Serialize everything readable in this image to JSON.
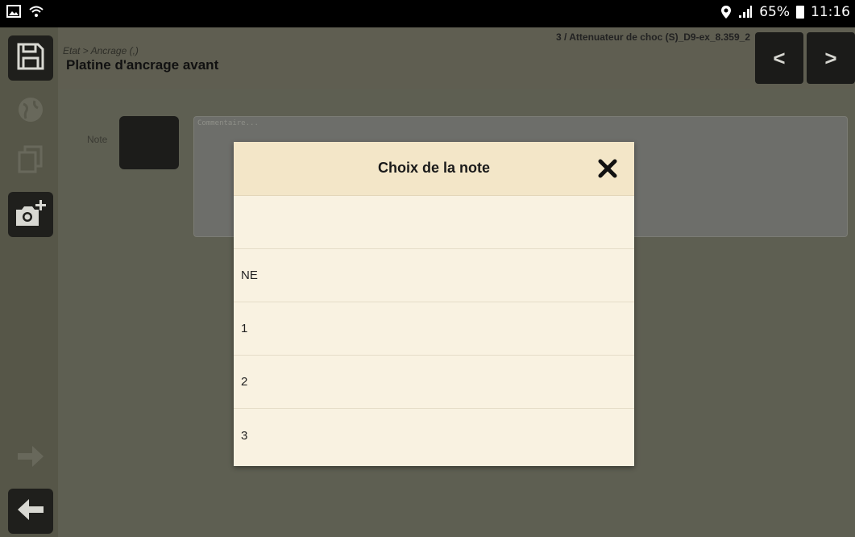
{
  "status_bar": {
    "battery": "65%",
    "time": "11:16",
    "icons": [
      "gallery-icon",
      "wifi-icon",
      "location-icon",
      "signal-icon",
      "battery-icon"
    ]
  },
  "rail": {
    "icons": [
      "save-icon",
      "globe-icon",
      "copy-icon",
      "camera-add-icon",
      "arrow-right-icon",
      "arrow-left-icon"
    ]
  },
  "header": {
    "breadcrumb": "Etat > Ancrage (,)",
    "title": "Platine d'ancrage avant",
    "record": "3 / Attenuateur de choc (S)_D9-ex_8.359_2",
    "prev_label": "<",
    "next_label": ">"
  },
  "form": {
    "note_label": "Note",
    "comment_placeholder": "Commentaire..."
  },
  "modal": {
    "title": "Choix de la note",
    "options": [
      "",
      "NE",
      "1",
      "2",
      "3"
    ]
  },
  "colors": {
    "modal_bg": "#f9f2e1",
    "modal_header": "#f3e6c8",
    "overlay": "#5d5e52"
  }
}
